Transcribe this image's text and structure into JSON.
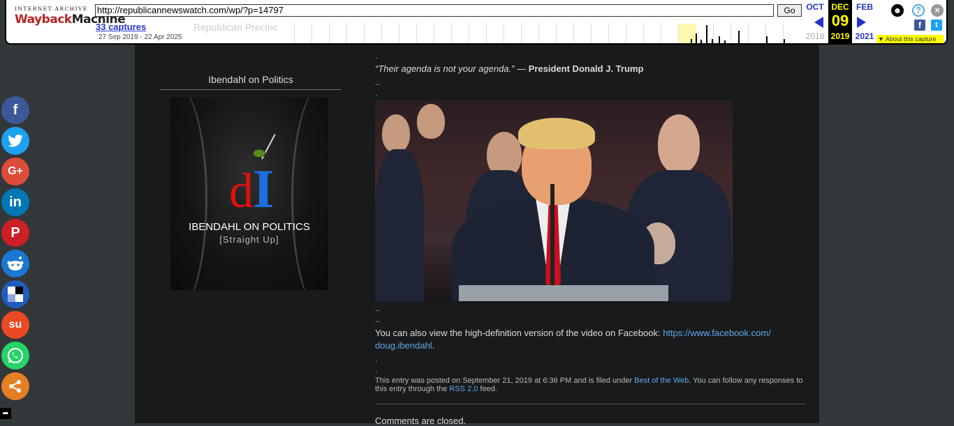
{
  "wayback": {
    "logo_top": "INTERNET ARCHIVE",
    "logo_wayback": "Wayback",
    "logo_machine": "Machine",
    "url": "http://republicannewswatch.com/wp/?p=14797",
    "go_label": "Go",
    "captures": "33 captures",
    "range": "27 Sep 2019 - 22 Apr 2025",
    "faded_title": "Republican Precinct",
    "prev_month": "OCT",
    "prev_year": "2018",
    "cur_month": "DEC",
    "cur_day": "09",
    "cur_year": "2019",
    "next_month": "FEB",
    "next_year": "2021",
    "about": "▼ About this capture",
    "colors": {
      "link": "#2233cc",
      "highlight": "#ffff00"
    }
  },
  "sidebar": {
    "title": "Ibendahl on Politics",
    "widget_title": "IBENDAHL ON POLITICS",
    "widget_subtitle": "[Straight Up]"
  },
  "post": {
    "dot1": ".",
    "quote_text": "“Their agenda is not your agenda.”",
    "quote_dash": " — ",
    "quote_author": "President Donald J. Trump",
    "dots_a": "..",
    "dot2": ".",
    "dots_b": "..",
    "dots_c": "..",
    "fb_text": "You can also view the high-definition version of the video on Facebook: ",
    "fb_link_1": "https://www.facebook.com/",
    "fb_link_2": "doug.ibendahl",
    "fb_end": ".",
    "dot3": ".",
    "dot4": ".",
    "meta_1": "This entry was posted on September 21, 2019 at 6:36 PM and is filed under ",
    "meta_cat": "Best of the Web",
    "meta_2": ". You can follow any responses to this entry through the ",
    "meta_rss": "RSS 2.0",
    "meta_3": " feed.",
    "comments_closed": "Comments are closed."
  },
  "share": {
    "buttons": [
      {
        "name": "facebook",
        "glyph": "f",
        "color": "#3b5998"
      },
      {
        "name": "twitter",
        "glyph": "t",
        "color": "#1da1f2"
      },
      {
        "name": "googleplus",
        "glyph": "G+",
        "color": "#dd4b39"
      },
      {
        "name": "linkedin",
        "glyph": "in",
        "color": "#0077b5"
      },
      {
        "name": "pinterest",
        "glyph": "P",
        "color": "#cb2027"
      },
      {
        "name": "reddit",
        "glyph": "r",
        "color": "#1a77d2"
      },
      {
        "name": "delicious",
        "glyph": "d",
        "color": "#205cc0"
      },
      {
        "name": "stumbleupon",
        "glyph": "su",
        "color": "#eb4924"
      },
      {
        "name": "whatsapp",
        "glyph": "w",
        "color": "#25d366"
      },
      {
        "name": "share",
        "glyph": "<",
        "color": "#e67e22"
      }
    ]
  }
}
